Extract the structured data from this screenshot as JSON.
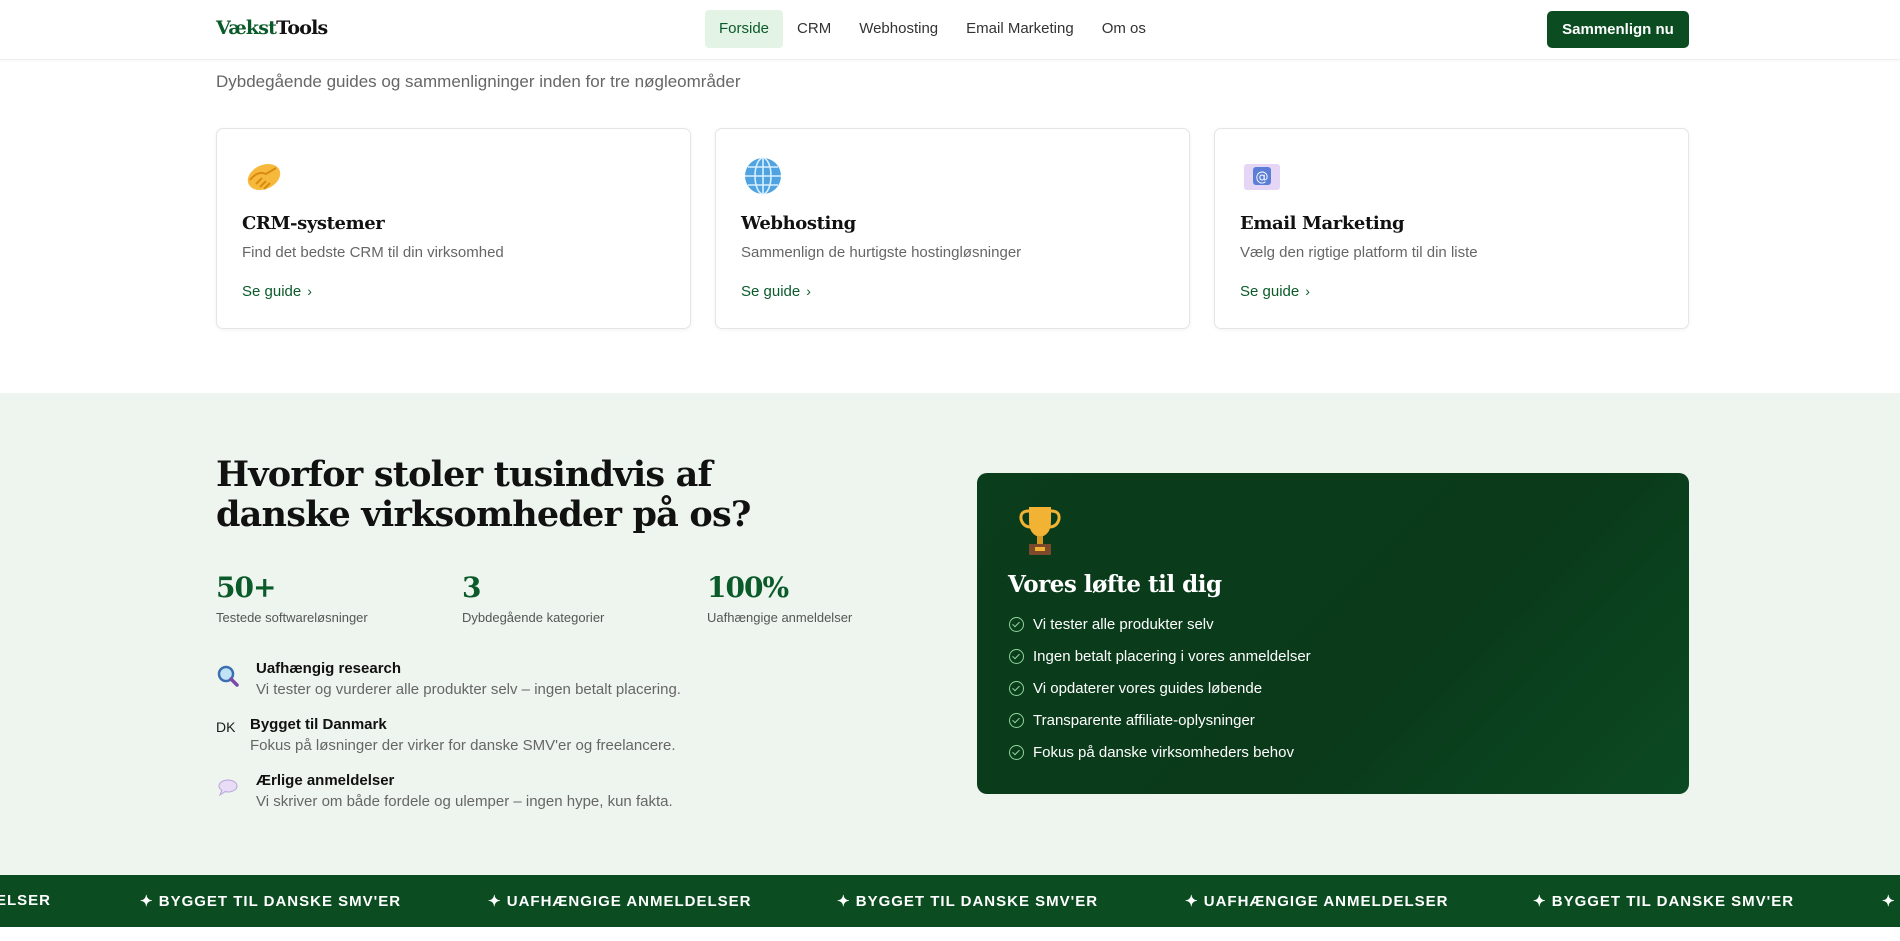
{
  "header": {
    "logo_part1": "Vækst",
    "logo_part2": "Tools",
    "nav": [
      "Forside",
      "CRM",
      "Webhosting",
      "Email Marketing",
      "Om os"
    ],
    "cta_label": "Sammenlign nu"
  },
  "intro": {
    "subtitle": "Dybdegående guides og sammenligninger inden for tre nøgleområder"
  },
  "cards": [
    {
      "icon": "handshake-icon",
      "title": "CRM-systemer",
      "desc": "Find det bedste CRM til din virksomhed",
      "link": "Se guide"
    },
    {
      "icon": "globe-icon",
      "title": "Webhosting",
      "desc": "Sammenlign de hurtigste hostingløsninger",
      "link": "Se guide"
    },
    {
      "icon": "email-icon",
      "title": "Email Marketing",
      "desc": "Vælg den rigtige platform til din liste",
      "link": "Se guide"
    }
  ],
  "trust": {
    "title": "Hvorfor stoler tusindvis af danske virksomheder på os?",
    "stats": [
      {
        "value": "50+",
        "label": "Testede softwareløsninger"
      },
      {
        "value": "3",
        "label": "Dybdegående kategorier"
      },
      {
        "value": "100%",
        "label": "Uafhængige anmeldelser"
      }
    ],
    "features": [
      {
        "icon": "magnifier-icon",
        "title": "Uafhængig research",
        "desc": "Vi tester og vurderer alle produkter selv – ingen betalt placering."
      },
      {
        "icon_text": "DK",
        "title": "Bygget til Danmark",
        "desc": "Fokus på løsninger der virker for danske SMV'er og freelancere."
      },
      {
        "icon": "speech-bubble-icon",
        "title": "Ærlige anmeldelser",
        "desc": "Vi skriver om både fordele og ulemper – ingen hype, kun fakta."
      }
    ]
  },
  "promise": {
    "icon": "trophy-icon",
    "title": "Vores løfte til dig",
    "items": [
      "Vi tester alle produkter selv",
      "Ingen betalt placering i vores anmeldelser",
      "Vi opdaterer vores guides løbende",
      "Transparente affiliate-oplysninger",
      "Fokus på danske virksomheders behov"
    ]
  },
  "ticker": {
    "items": [
      "ELSER",
      "✦ BYGGET TIL DANSKE SMV'ER",
      "✦ UAFHÆNGIGE ANMELDELSER",
      "✦ BYGGET TIL DANSKE SMV'ER",
      "✦ UAFHÆNGIGE ANMELDELSER",
      "✦ BYGGET TIL DANSKE SMV'ER",
      "✦"
    ]
  },
  "colors": {
    "brand_green": "#0b5a2a",
    "dark_green": "#0b4d21",
    "section_bg": "#eef5ef"
  }
}
